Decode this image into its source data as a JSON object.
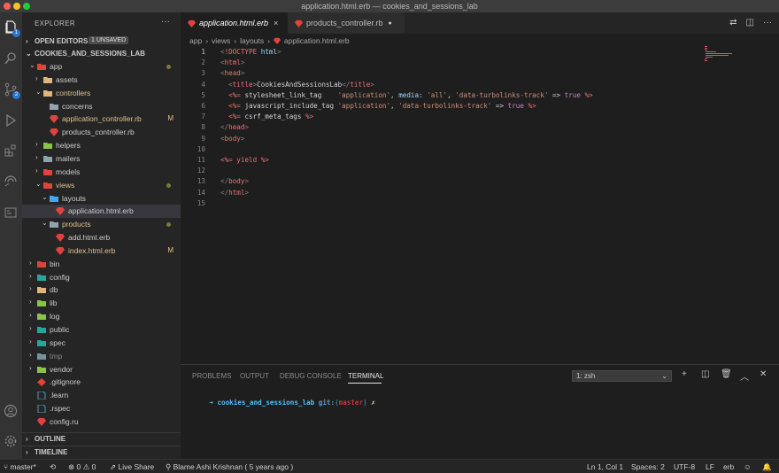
{
  "window": {
    "title": "application.html.erb — cookies_and_sessions_lab"
  },
  "activity_bar": {
    "explorer_badge": "1",
    "scm_badge": "2"
  },
  "sidebar": {
    "title": "EXPLORER",
    "more": "···",
    "open_editors": {
      "label": "OPEN EDITORS",
      "badge": "1 UNSAVED"
    },
    "project": {
      "label": "COOKIES_AND_SESSIONS_LAB"
    },
    "tree": [
      {
        "label": "app"
      },
      {
        "label": "assets"
      },
      {
        "label": "controllers"
      },
      {
        "label": "concerns"
      },
      {
        "label": "application_controller.rb",
        "status": "M"
      },
      {
        "label": "products_controller.rb"
      },
      {
        "label": "helpers"
      },
      {
        "label": "mailers"
      },
      {
        "label": "models"
      },
      {
        "label": "views"
      },
      {
        "label": "layouts"
      },
      {
        "label": "application.html.erb"
      },
      {
        "label": "products"
      },
      {
        "label": "add.html.erb"
      },
      {
        "label": "index.html.erb",
        "status": "M"
      },
      {
        "label": "bin"
      },
      {
        "label": "config"
      },
      {
        "label": "db"
      },
      {
        "label": "lib"
      },
      {
        "label": "log"
      },
      {
        "label": "public"
      },
      {
        "label": "spec"
      },
      {
        "label": "tmp"
      },
      {
        "label": "vendor"
      },
      {
        "label": ".gitignore"
      },
      {
        "label": ".learn"
      },
      {
        "label": ".rspec"
      },
      {
        "label": "config.ru"
      }
    ],
    "outline": "OUTLINE",
    "timeline": "TIMELINE"
  },
  "tabs": [
    {
      "label": "application.html.erb",
      "active": true,
      "close": "×"
    },
    {
      "label": "products_controller.rb",
      "active": false,
      "close": "●"
    }
  ],
  "breadcrumb": [
    "app",
    "views",
    "layouts",
    "application.html.erb"
  ],
  "breadcrumb_sep": "›",
  "editor": {
    "lines": [
      {
        "n": "1",
        "parts": [
          [
            "lt",
            "<"
          ],
          [
            "tg",
            "!DOCTYPE"
          ],
          [
            "txt",
            " "
          ],
          [
            "at",
            "html"
          ],
          [
            "lt",
            ">"
          ]
        ]
      },
      {
        "n": "2",
        "parts": [
          [
            "lt",
            "<"
          ],
          [
            "tg",
            "html"
          ],
          [
            "lt",
            ">"
          ]
        ]
      },
      {
        "n": "3",
        "parts": [
          [
            "lt",
            "<"
          ],
          [
            "tg",
            "head"
          ],
          [
            "lt",
            ">"
          ]
        ]
      },
      {
        "n": "4",
        "parts": [
          [
            "txt",
            "  "
          ],
          [
            "lt",
            "<"
          ],
          [
            "tg",
            "title"
          ],
          [
            "lt",
            ">"
          ],
          [
            "txt",
            "CookiesAndSessionsLab"
          ],
          [
            "lt",
            "</"
          ],
          [
            "tg",
            "title"
          ],
          [
            "lt",
            ">"
          ]
        ]
      },
      {
        "n": "5",
        "parts": [
          [
            "txt",
            "  "
          ],
          [
            "erb",
            "<%="
          ],
          [
            "txt",
            " stylesheet_link_tag    "
          ],
          [
            "st1",
            "'application'"
          ],
          [
            "txt",
            ", "
          ],
          [
            "at",
            "media:"
          ],
          [
            "txt",
            " "
          ],
          [
            "st1",
            "'all'"
          ],
          [
            "txt",
            ", "
          ],
          [
            "st1",
            "'data-turbolinks-track'"
          ],
          [
            "txt",
            " => "
          ],
          [
            "kw",
            "true"
          ],
          [
            "txt",
            " "
          ],
          [
            "erb",
            "%>"
          ]
        ]
      },
      {
        "n": "6",
        "parts": [
          [
            "txt",
            "  "
          ],
          [
            "erb",
            "<%="
          ],
          [
            "txt",
            " javascript_include_tag "
          ],
          [
            "st1",
            "'application'"
          ],
          [
            "txt",
            ", "
          ],
          [
            "st1",
            "'data-turbolinks-track'"
          ],
          [
            "txt",
            " => "
          ],
          [
            "kw",
            "true"
          ],
          [
            "txt",
            " "
          ],
          [
            "erb",
            "%>"
          ]
        ]
      },
      {
        "n": "7",
        "parts": [
          [
            "txt",
            "  "
          ],
          [
            "erb",
            "<%="
          ],
          [
            "txt",
            " csrf_meta_tags "
          ],
          [
            "erb",
            "%>"
          ]
        ]
      },
      {
        "n": "8",
        "parts": [
          [
            "lt",
            "</"
          ],
          [
            "tg",
            "head"
          ],
          [
            "lt",
            ">"
          ]
        ]
      },
      {
        "n": "9",
        "parts": [
          [
            "lt",
            "<"
          ],
          [
            "tg",
            "body"
          ],
          [
            "lt",
            ">"
          ]
        ]
      },
      {
        "n": "10",
        "parts": []
      },
      {
        "n": "11",
        "parts": [
          [
            "erb",
            "<%="
          ],
          [
            "txt",
            " "
          ],
          [
            "erb",
            "yield"
          ],
          [
            "txt",
            " "
          ],
          [
            "erb",
            "%>"
          ]
        ]
      },
      {
        "n": "12",
        "parts": []
      },
      {
        "n": "13",
        "parts": [
          [
            "lt",
            "</"
          ],
          [
            "tg",
            "body"
          ],
          [
            "lt",
            ">"
          ]
        ]
      },
      {
        "n": "14",
        "parts": [
          [
            "lt",
            "</"
          ],
          [
            "tg",
            "html"
          ],
          [
            "lt",
            ">"
          ]
        ]
      },
      {
        "n": "15",
        "parts": []
      }
    ]
  },
  "panel": {
    "tabs": [
      "PROBLEMS",
      "OUTPUT",
      "DEBUG CONSOLE",
      "TERMINAL"
    ],
    "active_tab": "TERMINAL",
    "terminal_select": "1: zsh",
    "prompt": {
      "arrow": "➜",
      "dir": "cookies_and_sessions_lab",
      "git": "git:",
      "branch_open": "(",
      "branch": "master",
      "branch_close": ")",
      "mark": "✗"
    }
  },
  "statusbar": {
    "branch": "master*",
    "errors": "0",
    "warnings": "0",
    "live_share": "Live Share",
    "blame": "Blame Ashi Krishnan ( 5 years ago )",
    "position": "Ln 1, Col 1",
    "spaces": "Spaces: 2",
    "encoding": "UTF-8",
    "eol": "LF",
    "language": "erb"
  },
  "colors": {
    "accent_blue": "#2a76d2",
    "ruby_red": "#e0433c",
    "folder": "#dcb67a",
    "modified": "#e2c08d"
  }
}
